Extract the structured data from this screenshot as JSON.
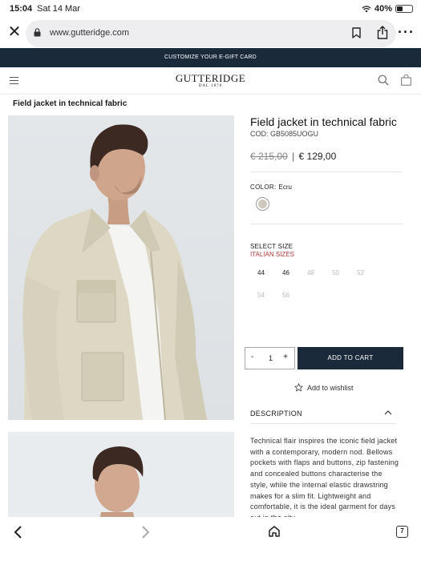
{
  "status_bar": {
    "time": "15:04",
    "date": "Sat 14 Mar",
    "battery": "40%",
    "battery_level": 0.4
  },
  "browser": {
    "url": "www.gutteridge.com",
    "tab_count": "7"
  },
  "promo": {
    "text": "CUSTOMIZE YOUR E-GIFT CARD"
  },
  "site": {
    "brand": "GUTTERIDGE",
    "since": "DAL 1878"
  },
  "page": {
    "title": "Field jacket in technical fabric"
  },
  "product": {
    "name": "Field jacket in technical fabric",
    "code": "COD: GB5085UOGU",
    "old_price": "€ 215,00",
    "price_separator": "|",
    "new_price": "€ 129,00",
    "color_label": "COLOR:",
    "color_value": "Ecru",
    "color_hex": "#cfc9bd",
    "size_label": "SELECT SIZE",
    "size_system": "ITALIAN SIZES",
    "sizes": [
      {
        "label": "44",
        "available": true
      },
      {
        "label": "46",
        "available": true
      },
      {
        "label": "48",
        "available": false
      },
      {
        "label": "50",
        "available": false
      },
      {
        "label": "52",
        "available": false
      },
      {
        "label": "54",
        "available": false
      },
      {
        "label": "56",
        "available": false
      }
    ],
    "quantity": {
      "minus": "-",
      "value": "1",
      "plus": "+"
    },
    "add_to_cart": "ADD TO CART",
    "wishlist": "Add to wishlist",
    "description_label": "DESCRIPTION",
    "description_text": "Technical flair inspires the iconic field jacket with a contemporary, modern nod. Bellows pockets with flaps and buttons, zip fastening and concealed buttons characterise the style, while the internal elastic drawstring makes for a slim fit. Lightweight and comfortable, it is the ideal garment for days out in the city."
  },
  "colors": {
    "navy": "#1b2a3b",
    "accent_red": "#b33a3a"
  },
  "icons": [
    "close-icon",
    "lock-icon",
    "bookmark-icon",
    "share-icon",
    "more-icon",
    "menu-icon",
    "search-icon",
    "bag-icon",
    "star-icon",
    "chevron-up-icon",
    "back-arrow-icon",
    "forward-arrow-icon",
    "home-icon",
    "tabs-icon"
  ]
}
